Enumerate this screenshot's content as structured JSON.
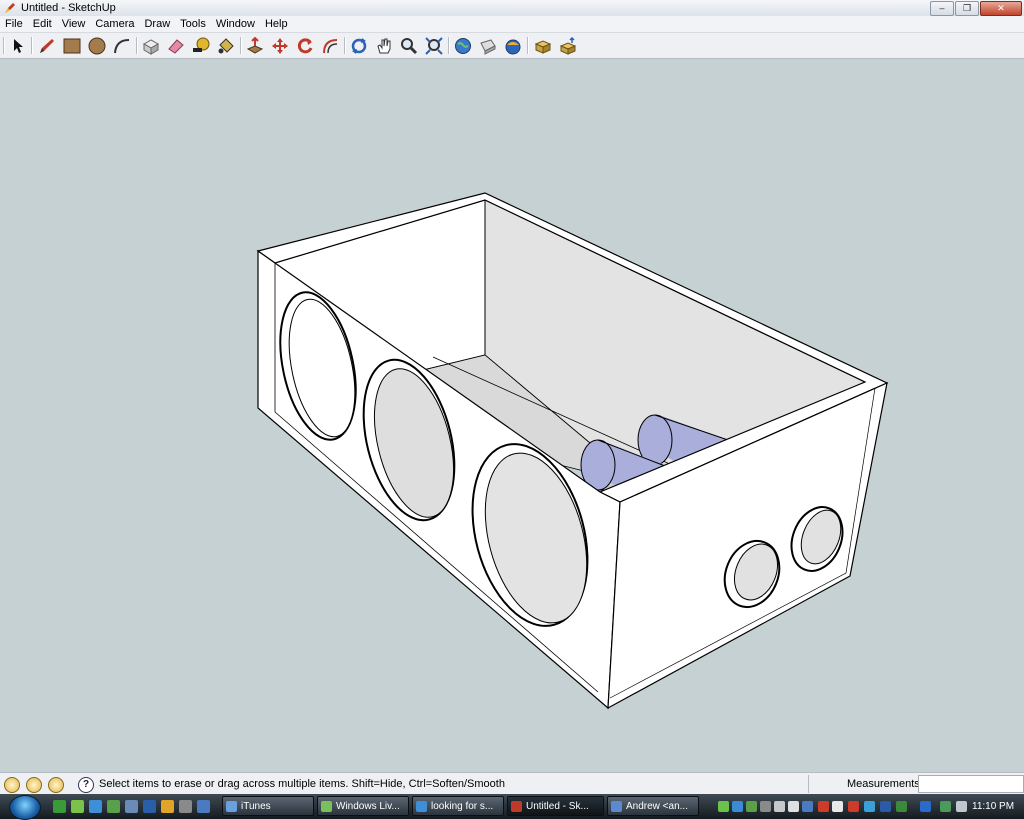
{
  "window": {
    "title": "Untitled - SketchUp",
    "buttons": {
      "minimize": "–",
      "restore": "❐",
      "close": "✕"
    }
  },
  "menu": [
    "File",
    "Edit",
    "View",
    "Camera",
    "Draw",
    "Tools",
    "Window",
    "Help"
  ],
  "toolbar": {
    "tools": [
      {
        "name": "select-tool",
        "icon": "arrow-icon"
      },
      {
        "name": "line-tool",
        "icon": "pencil-icon"
      },
      {
        "name": "rectangle-tool",
        "icon": "rectangle-icon"
      },
      {
        "name": "circle-tool",
        "icon": "circle-icon"
      },
      {
        "name": "arc-tool",
        "icon": "arc-icon"
      },
      {
        "name": "make-component-tool",
        "icon": "component-icon"
      },
      {
        "name": "eraser-tool",
        "icon": "eraser-icon"
      },
      {
        "name": "tape-measure-tool",
        "icon": "tape-icon"
      },
      {
        "name": "paint-bucket-tool",
        "icon": "bucket-icon"
      },
      {
        "name": "push-pull-tool",
        "icon": "pushpull-icon"
      },
      {
        "name": "move-tool",
        "icon": "move-icon"
      },
      {
        "name": "rotate-tool",
        "icon": "rotate-icon"
      },
      {
        "name": "offset-tool",
        "icon": "offset-icon"
      },
      {
        "name": "orbit-tool",
        "icon": "orbit-icon"
      },
      {
        "name": "pan-tool",
        "icon": "hand-icon"
      },
      {
        "name": "zoom-tool",
        "icon": "magnifier-icon"
      },
      {
        "name": "zoom-extents-tool",
        "icon": "zoom-extents-icon"
      },
      {
        "name": "get-models-tool",
        "icon": "globe-icon"
      },
      {
        "name": "share-model-tool",
        "icon": "share-icon"
      },
      {
        "name": "earth-tool",
        "icon": "earth-icon"
      },
      {
        "name": "get-component-tool",
        "icon": "box-down-icon"
      },
      {
        "name": "share-component-tool",
        "icon": "box-up-icon"
      }
    ]
  },
  "status": {
    "hint": "Select items to erase or drag across multiple items. Shift=Hide, Ctrl=Soften/Smooth",
    "help_glyph": "?",
    "measurements_label": "Measurements",
    "measurements_value": ""
  },
  "taskbar": {
    "buttons": [
      {
        "label": "iTunes",
        "active": false
      },
      {
        "label": "Windows Liv...",
        "active": false
      },
      {
        "label": "looking for s...",
        "active": false
      },
      {
        "label": "Untitled - Sk...",
        "active": true
      },
      {
        "label": "Andrew <an...",
        "active": false
      }
    ],
    "clock": "11:10 PM"
  },
  "colors": {
    "viewport_background": "#c5d1d3",
    "box_face_light": "#ffffff",
    "box_face_inner": "#e6e6e6",
    "cylinder": "#a9aedb",
    "edge": "#000000"
  }
}
